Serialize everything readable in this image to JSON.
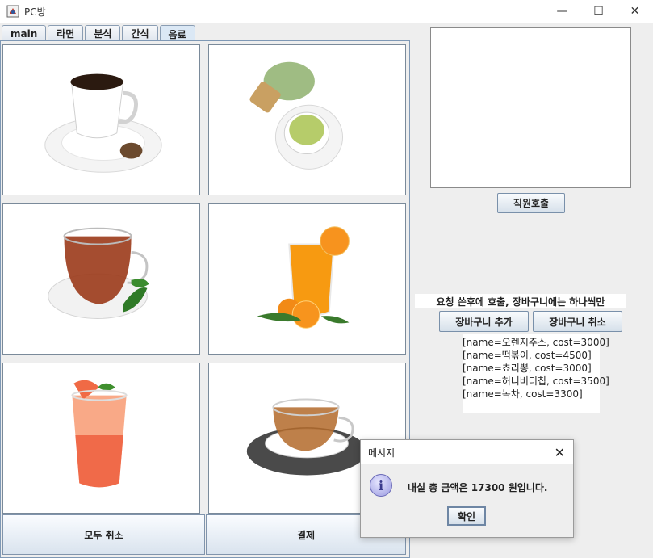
{
  "window": {
    "title": "PC방",
    "minimize_glyph": "—",
    "maximize_glyph": "☐",
    "close_glyph": "✕"
  },
  "tabs": [
    {
      "label": "main"
    },
    {
      "label": "라면"
    },
    {
      "label": "분식"
    },
    {
      "label": "간식"
    },
    {
      "label": "음료"
    }
  ],
  "active_tab": "음료",
  "menu_items": [
    {
      "icon": "coffee-cup-icon"
    },
    {
      "icon": "matcha-latte-icon"
    },
    {
      "icon": "black-tea-icon"
    },
    {
      "icon": "orange-juice-icon"
    },
    {
      "icon": "grapefruit-ade-icon"
    },
    {
      "icon": "herbal-tea-icon"
    }
  ],
  "bottom_buttons": {
    "cancel_all": "모두 취소",
    "pay": "결제"
  },
  "right_panel": {
    "call_staff": "직원호출",
    "notice": "요청 쓴후에 호출, 장바구니에는 하나씩만",
    "add_to_cart": "장바구니 추가",
    "remove_from_cart": "장바구니 취소"
  },
  "cart": [
    "[name=오렌지주스, cost=3000]",
    "[name=떡볶이, cost=4500]",
    "[name=쵸리뽕, cost=3000]",
    "[name=허니버터칩, cost=3500]",
    "[name=녹차, cost=3300]"
  ],
  "dialog": {
    "title": "메시지",
    "message": "내실 총 금액은 17300 원입니다.",
    "ok": "확인",
    "icon_glyph": "i",
    "close_glyph": "✕"
  },
  "colors": {
    "accent_border": "#7e98b5",
    "button_gradient_top": "#f9fbfd",
    "button_gradient_bottom": "#d6e0ea"
  }
}
